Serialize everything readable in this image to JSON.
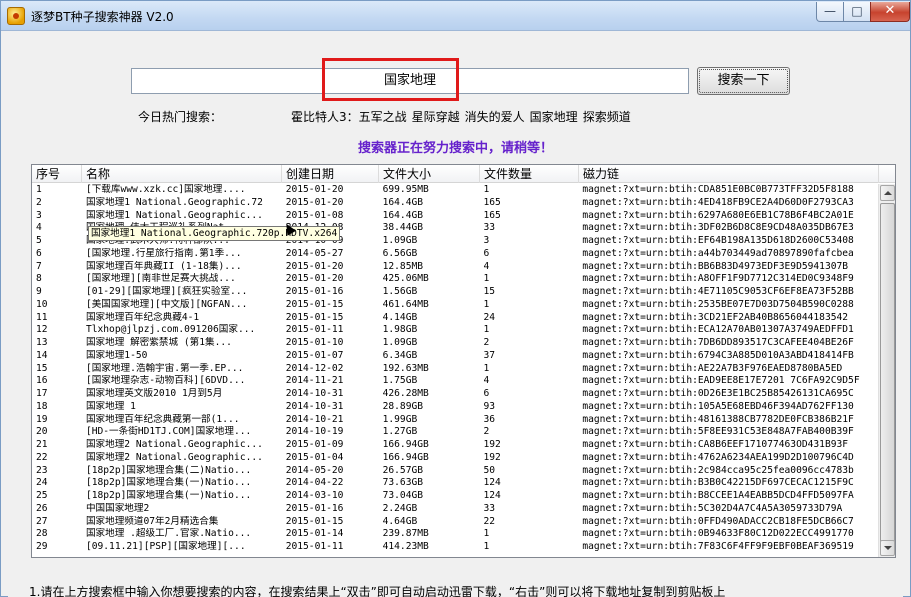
{
  "window": {
    "title": "逐梦BT种子搜索神器 V2.0",
    "controls": {
      "minimize": "—",
      "maximize": "□",
      "close": "✕"
    }
  },
  "search": {
    "query": "国家地理",
    "button_label": "搜索一下"
  },
  "hot": {
    "label": "今日热门搜索：",
    "items": [
      "霍比特人3：五军之战",
      "星际穿越",
      "消失的爱人",
      "国家地理",
      "探索频道"
    ]
  },
  "status": {
    "text": "搜索器正在努力搜索中，请稍等！"
  },
  "table": {
    "columns": [
      "序号",
      "名称",
      "创建日期",
      "文件大小",
      "文件数量",
      "磁力链"
    ],
    "rows": [
      [
        "1",
        "[下载库www.xzk.cc]国家地理....",
        "2015-01-20",
        "699.95MB",
        "1",
        "magnet:?xt=urn:btih:CDA851E0BC0B773TFF32D5F8188"
      ],
      [
        "2",
        "国家地理1 National.Geographic.72",
        "2015-01-20",
        "164.4GB",
        "165",
        "magnet:?xt=urn:btih:4ED418FB9CE2A4D60D0F2793CA3"
      ],
      [
        "3",
        "国家地理1 National.Geographic...",
        "2015-01-08",
        "164.4GB",
        "165",
        "magnet:?xt=urn:btih:6297A680E6EB1C78B6F4BC2A01E"
      ],
      [
        "4",
        "国家地理.伟大工程巡礼系列Nat...",
        "2014-12-08",
        "38.44GB",
        "33",
        "magnet:?xt=urn:btih:3DF02B6D8C8E9CD48A035DB67E3"
      ],
      [
        "5",
        "国家地理.武术大师.特种部队...",
        "2014-10-09",
        "1.09GB",
        "3",
        "magnet:?xt=urn:btih:EF64B198A135D618D2600C53408"
      ],
      [
        "6",
        "[国家地理.行星旅行指南.第1季...",
        "2014-05-27",
        "6.56GB",
        "6",
        "magnet:?xt=urn:btih:a44b703449ad70897890fafcbea"
      ],
      [
        "7",
        "国家地理百年典藏II (1-18集)...",
        "2015-01-20",
        "12.85MB",
        "4",
        "magnet:?xt=urn:btih:BB6B83D4973EDF3E9D5941307B"
      ],
      [
        "8",
        "[国家地理][南非世足赛大挑战...",
        "2015-01-20",
        "425.06MB",
        "1",
        "magnet:?xt=urn:btih:A8OFF1F9D7712C314ED0C9348F9"
      ],
      [
        "9",
        "[01-29][国家地理][疯狂实验室...",
        "2015-01-16",
        "1.56GB",
        "15",
        "magnet:?xt=urn:btih:4E71105C9053CF6EF8EA73F52BB"
      ],
      [
        "10",
        "[美国国家地理][中文版][NGFAN...",
        "2015-01-15",
        "461.64MB",
        "1",
        "magnet:?xt=urn:btih:2535BE07E7D03D7504B590C0288"
      ],
      [
        "11",
        "国家地理百年纪念典藏4-1",
        "2015-01-15",
        "4.14GB",
        "24",
        "magnet:?xt=urn:btih:3CD21EF2AB40B8656044183542"
      ],
      [
        "12",
        "Tlxhop@jlpzj.com.091206国家...",
        "2015-01-11",
        "1.98GB",
        "1",
        "magnet:?xt=urn:btih:ECA12A70AB01307A3749AEDFFD1"
      ],
      [
        "13",
        "国家地理 解密紫禁城 (第1集...",
        "2015-01-10",
        "1.09GB",
        "2",
        "magnet:?xt=urn:btih:7DB6DD893517C3CAFEE404BE26F"
      ],
      [
        "14",
        "国家地理1-50",
        "2015-01-07",
        "6.34GB",
        "37",
        "magnet:?xt=urn:btih:6794C3A885D010A3ABD418414FB"
      ],
      [
        "15",
        "[国家地理.浩翰宇宙.第一季.EP...",
        "2014-12-02",
        "192.63MB",
        "1",
        "magnet:?xt=urn:btih:AE22A7B3F976EAED8780BA5ED"
      ],
      [
        "16",
        "[国家地理杂志-动物百科][6DVD...",
        "2014-11-21",
        "1.75GB",
        "4",
        "magnet:?xt=urn:btih:EAD9EE8E17E7201 7C6FA92C9D5F"
      ],
      [
        "17",
        "国家地理英文版2010 1月到5月",
        "2014-10-31",
        "426.28MB",
        "6",
        "magnet:?xt=urn:btih:0D26E3E1BC25B85426131CA695C"
      ],
      [
        "18",
        "国家地理 1",
        "2014-10-31",
        "28.89GB",
        "93",
        "magnet:?xt=urn:btih:105A5E68EBD46F394AD762FF130"
      ],
      [
        "19",
        "国家地理百年纪念典藏第一部(1...",
        "2014-10-21",
        "1.99GB",
        "36",
        "magnet:?xt=urn:btih:48161388CB7782DE0FCB386B21F"
      ],
      [
        "20",
        "[HD-一条街HD1TJ.COM]国家地理...",
        "2014-10-19",
        "1.27GB",
        "2",
        "magnet:?xt=urn:btih:5F8EE931C53E848A7FAB400B39F"
      ],
      [
        "21",
        "国家地理2 National.Geographic...",
        "2015-01-09",
        "166.94GB",
        "192",
        "magnet:?xt=urn:btih:CA8B6EEF171077463OD431B93F"
      ],
      [
        "22",
        "国家地理2 National.Geographic...",
        "2015-01-04",
        "166.94GB",
        "192",
        "magnet:?xt=urn:btih:4762A6234AEA199D2D100796C4D"
      ],
      [
        "23",
        "[18p2p]国家地理合集(二)Natio...",
        "2014-05-20",
        "26.57GB",
        "50",
        "magnet:?xt=urn:btih:2c984cca95c25fea0096cc4783b"
      ],
      [
        "24",
        "[18p2p]国家地理合集(一)Natio...",
        "2014-04-22",
        "73.63GB",
        "124",
        "magnet:?xt=urn:btih:B3B0C42215DF697CECAC1215F9C"
      ],
      [
        "25",
        "[18p2p]国家地理合集(一)Natio...",
        "2014-03-10",
        "73.04GB",
        "124",
        "magnet:?xt=urn:btih:B8CCEE1A4EABB5DCD4FFD5097FA"
      ],
      [
        "26",
        "中国国家地理2",
        "2015-01-16",
        "2.24GB",
        "33",
        "magnet:?xt=urn:btih:5C302D4A7C4A5A3059733D79A"
      ],
      [
        "27",
        "国家地理频道07年2月精选合集",
        "2015-01-15",
        "4.64GB",
        "22",
        "magnet:?xt=urn:btih:0FFD490ADACC2CB18FE5DCB66C7"
      ],
      [
        "28",
        "国家地理 .超级工厂.官家.Natio...",
        "2015-01-14",
        "239.87MB",
        "1",
        "magnet:?xt=urn:btih:0B94633F80C12D022ECC4991770"
      ],
      [
        "29",
        "[09.11.21][PSP][国家地理][...",
        "2015-01-11",
        "414.23MB",
        "1",
        "magnet:?xt=urn:btih:7F83C6F4FF9F9EBF0BEAF369519"
      ]
    ]
  },
  "tooltip": {
    "text": "国家地理1 National.Geographic.720p.HDTV.x264"
  },
  "footer": {
    "instructions": "1.请在上方搜索框中输入你想要搜索的内容，在搜索结果上“双击”即可自动启动迅雷下载，“右击”则可以将下载地址复制到剪贴板上"
  }
}
